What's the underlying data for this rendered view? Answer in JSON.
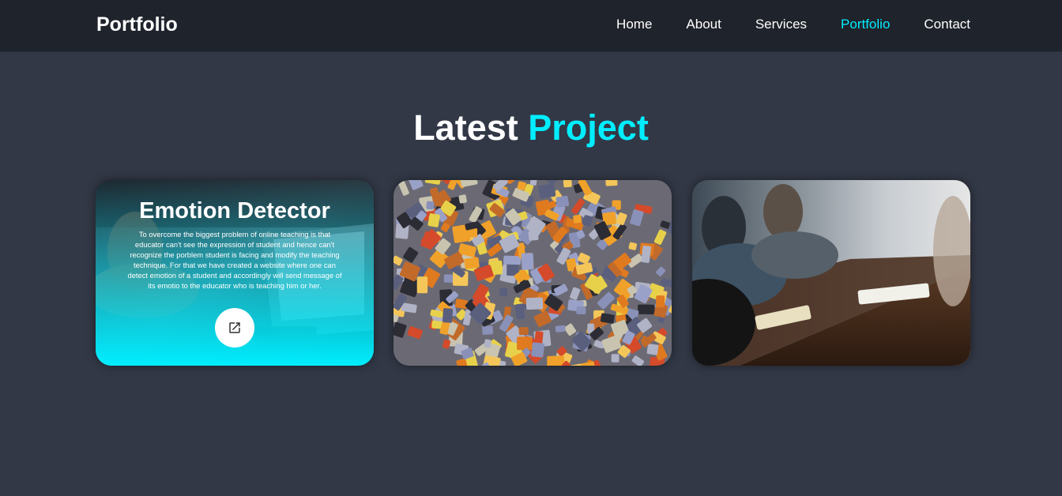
{
  "header": {
    "logo": "Portfolio",
    "nav": [
      {
        "label": "Home",
        "active": false
      },
      {
        "label": "About",
        "active": false
      },
      {
        "label": "Services",
        "active": false
      },
      {
        "label": "Portfolio",
        "active": true
      },
      {
        "label": "Contact",
        "active": false
      }
    ]
  },
  "section": {
    "heading_main": "Latest",
    "heading_accent": "Project"
  },
  "projects": [
    {
      "title": "Emotion Detector",
      "description": "To overcome the biggest problem of online teaching is that educator can't see the expression of student and hence can't recognize the porblem student is facing and modify the teaching technique. For that we have created a website where one can detect emotion of a student and accordingly will send message of its emotio to the educator who is teaching him or her.",
      "image": "laptop-work-photo",
      "link_icon": "external-link-icon"
    },
    {
      "image": "puzzle-pieces-photo"
    },
    {
      "image": "meeting-table-photo"
    }
  ],
  "colors": {
    "accent": "#00eeff",
    "background": "#323846",
    "header_bg": "#1f232b"
  }
}
